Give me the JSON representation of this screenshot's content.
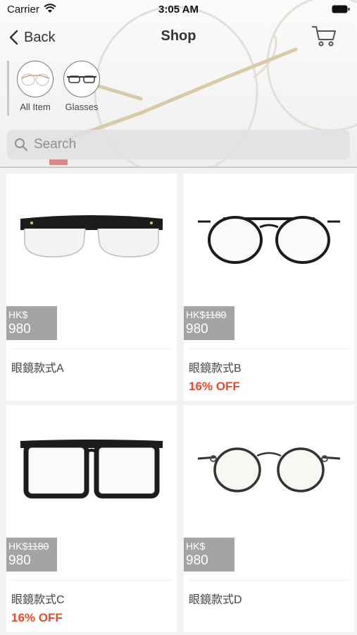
{
  "status_bar": {
    "carrier": "Carrier",
    "time": "3:05 AM"
  },
  "nav": {
    "back_label": "Back",
    "title": "Shop"
  },
  "categories": [
    {
      "label": "All Item",
      "icon": "round-glasses-icon"
    },
    {
      "label": "Glasses",
      "icon": "glasses-icon"
    }
  ],
  "search": {
    "placeholder": "Search"
  },
  "products": [
    {
      "name": "眼鏡款式A",
      "currency": "HK$",
      "old_price": "",
      "price": "980",
      "discount": ""
    },
    {
      "name": "眼鏡款式B",
      "currency": "HK$",
      "old_price": "1180",
      "price": "980",
      "discount": "16% OFF"
    },
    {
      "name": "眼鏡款式C",
      "currency": "HK$",
      "old_price": "1180",
      "price": "980",
      "discount": "16% OFF"
    },
    {
      "name": "眼鏡款式D",
      "currency": "HK$",
      "old_price": "",
      "price": "980",
      "discount": ""
    }
  ],
  "colors": {
    "accent": "#e8492b",
    "price_tag": "#a4a4a4",
    "text": "#444444"
  }
}
